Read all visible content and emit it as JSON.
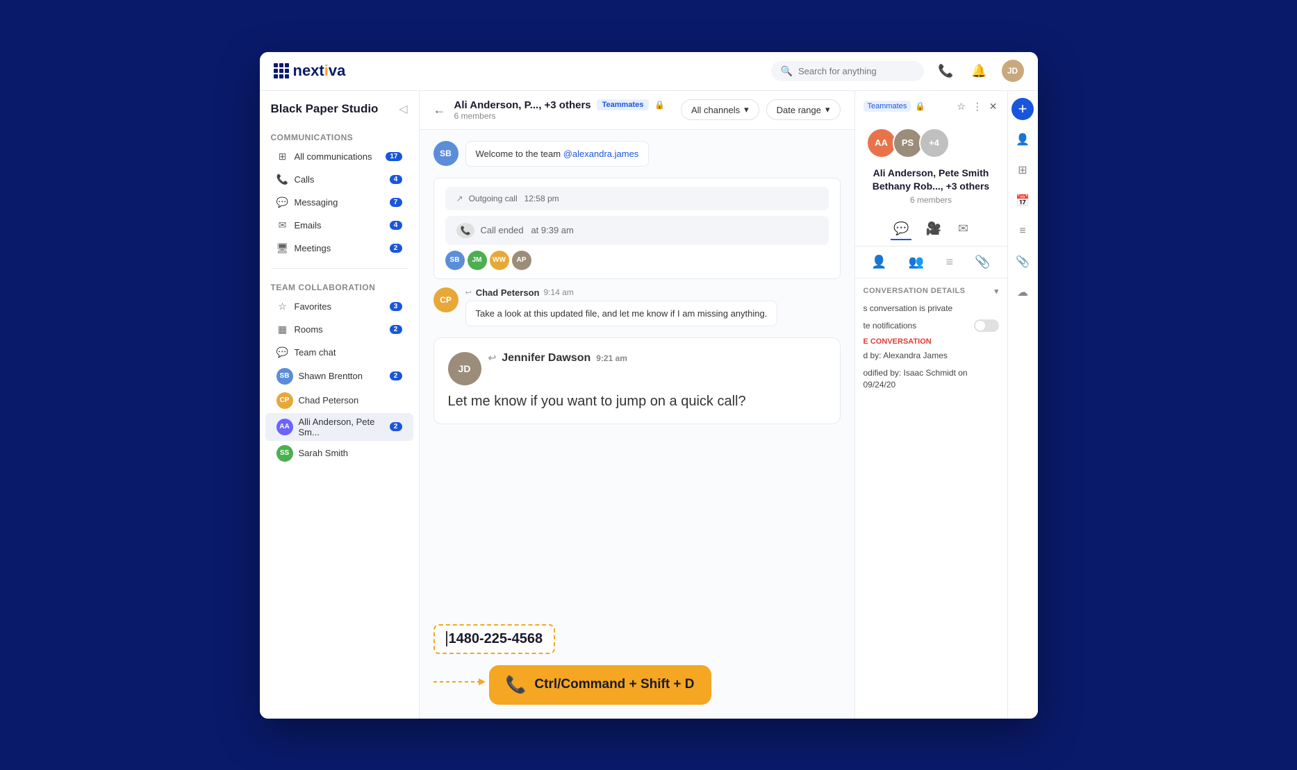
{
  "app": {
    "name": "nextiva",
    "logo_dot": "·"
  },
  "topnav": {
    "search_placeholder": "Search for anything",
    "phone_icon": "📞",
    "bell_icon": "🔔",
    "avatar_initials": "JD"
  },
  "sidebar": {
    "workspace": "Black Paper Studio",
    "sections": {
      "communications": {
        "label": "Communications",
        "items": [
          {
            "id": "all-comms",
            "label": "All communications",
            "badge": "17",
            "icon": "⊞"
          },
          {
            "id": "calls",
            "label": "Calls",
            "badge": "4",
            "icon": "📞"
          },
          {
            "id": "messaging",
            "label": "Messaging",
            "badge": "7",
            "icon": "💬"
          },
          {
            "id": "emails",
            "label": "Emails",
            "badge": "4",
            "icon": "✉"
          },
          {
            "id": "meetings",
            "label": "Meetings",
            "badge": "2",
            "icon": "🖥"
          }
        ]
      },
      "team_collaboration": {
        "label": "Team collaboration",
        "items": [
          {
            "id": "favorites",
            "label": "Favorites",
            "badge": "3",
            "icon": "☆"
          },
          {
            "id": "rooms",
            "label": "Rooms",
            "badge": "2",
            "icon": "▦"
          },
          {
            "id": "teamchat",
            "label": "Team chat",
            "badge": "",
            "icon": "💬"
          }
        ]
      },
      "team_chat_members": [
        {
          "id": "shawn",
          "name": "Shawn Brentton",
          "badge": "2",
          "color": "#5b8dd9"
        },
        {
          "id": "chad",
          "name": "Chad Peterson",
          "badge": "",
          "color": "#e8a838"
        },
        {
          "id": "alli",
          "name": "Alli Anderson, Pete Sm...",
          "badge": "2",
          "color": "#6c63ff",
          "active": true
        },
        {
          "id": "sarah",
          "name": "Sarah Smith",
          "badge": "",
          "color": "#4caf50"
        }
      ]
    }
  },
  "chat": {
    "header": {
      "title": "Ali Anderson, P..., +3 others",
      "tag": "Teammates",
      "members_count": "6 members",
      "filter1": "All channels",
      "filter2": "Date range"
    },
    "messages": [
      {
        "id": "msg1",
        "type": "text",
        "sender": "",
        "avatar_color": "#5b8dd9",
        "avatar_initials": "SB",
        "text": "Welcome to the team @alexandra.james",
        "mention": "@alexandra.james",
        "time": ""
      },
      {
        "id": "msg2",
        "type": "system",
        "text": "Outgoing call  12:58 pm"
      },
      {
        "id": "msg3",
        "type": "call_ended",
        "text": "Call ended  at 9:39 am"
      },
      {
        "id": "msg4",
        "type": "text",
        "sender": "Chad Peterson",
        "avatar_color": "#e8a838",
        "avatar_initials": "CP",
        "time": "9:14 am",
        "text": "Take a look at this updated file, and let me know if I am missing anything."
      },
      {
        "id": "msg5",
        "type": "big",
        "sender": "Jennifer Dawson",
        "avatar_color": "#9c8c7a",
        "avatar_initials": "JD",
        "time": "9:21 am",
        "text": "Let me know if you want to jump on a quick call?"
      }
    ],
    "phone_number": "1480-225-4568",
    "shortcut": "Ctrl/Command + Shift + D"
  },
  "right_panel": {
    "tag": "Teammates",
    "members": {
      "names_line1": "Ali Anderson, Pete Smith",
      "names_line2": "Bethany Rob..., +3 others",
      "count": "6 members",
      "avatars": [
        {
          "initials": "AA",
          "color": "#e8734a"
        },
        {
          "initials": "PS",
          "color": "#9c8c7a"
        },
        {
          "initials": "+4",
          "color": "#c0c0c0"
        }
      ]
    },
    "conv_details": {
      "title": "CONVERSATION DETAILS",
      "private_label": "s conversation is private",
      "notifications_label": "te notifications",
      "action_label": "E CONVERSATION",
      "created_by": "d by: Alexandra James",
      "modified_by": "odified by: Isaac Schmidt on 09/24/20"
    }
  },
  "call_participants": [
    {
      "initials": "SB",
      "color": "#5b8dd9"
    },
    {
      "initials": "JM",
      "color": "#4caf50"
    },
    {
      "initials": "WW",
      "color": "#e8a838"
    },
    {
      "initials": "AP",
      "color": "#9c8c7a"
    }
  ]
}
